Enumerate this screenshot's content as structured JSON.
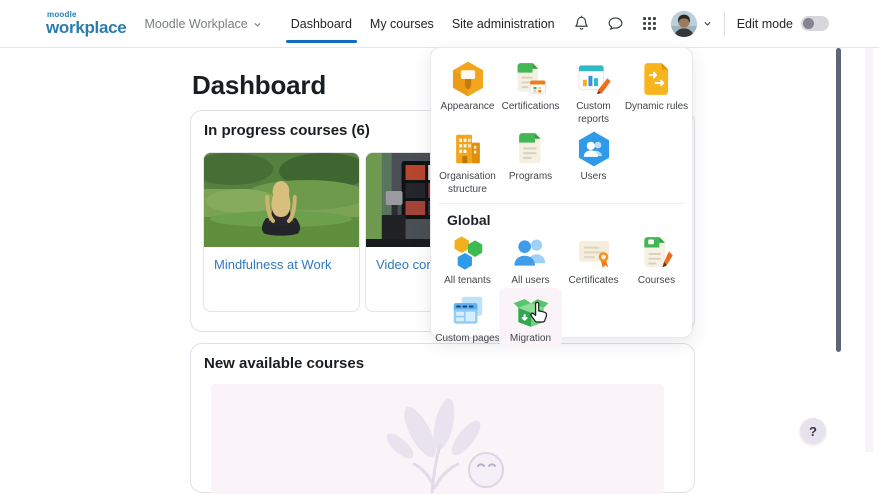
{
  "colors": {
    "brand_blue": "#2a7cb0",
    "accent_blue": "#0f6cbf",
    "link_blue": "#3178be",
    "scrollbar_thumb": "#5f6673",
    "hover_pink": "#faf4f8"
  },
  "navbar": {
    "logo_top": "moodle",
    "logo_bottom": "workplace",
    "tenant_menu": "Moodle Workplace",
    "links": [
      {
        "label": "Dashboard",
        "active": true
      },
      {
        "label": "My courses",
        "active": false
      },
      {
        "label": "Site administration",
        "active": false
      }
    ],
    "icons": [
      "notifications-bell",
      "messages",
      "app-launcher-grid",
      "user-avatar",
      "chevron-down"
    ],
    "edit_mode_label": "Edit mode",
    "edit_mode_on": false
  },
  "launcher_menu": {
    "tenant_items": [
      {
        "label": "Appearance",
        "icon": "appearance-icon"
      },
      {
        "label": "Certifications",
        "icon": "certifications-icon"
      },
      {
        "label": "Custom reports",
        "icon": "custom-reports-icon"
      },
      {
        "label": "Dynamic rules",
        "icon": "dynamic-rules-icon"
      },
      {
        "label": "Organisation structure",
        "icon": "organisation-structure-icon"
      },
      {
        "label": "Programs",
        "icon": "programs-icon"
      },
      {
        "label": "Users",
        "icon": "users-icon"
      }
    ],
    "global_heading": "Global",
    "global_items": [
      {
        "label": "All tenants",
        "icon": "all-tenants-icon"
      },
      {
        "label": "All users",
        "icon": "all-users-icon"
      },
      {
        "label": "Certificates",
        "icon": "certificates-icon"
      },
      {
        "label": "Courses",
        "icon": "courses-icon"
      },
      {
        "label": "Custom pages",
        "icon": "custom-pages-icon"
      },
      {
        "label": "Migration",
        "icon": "migration-icon",
        "hovered": true
      }
    ]
  },
  "main": {
    "page_title": "Dashboard",
    "in_progress_section": {
      "title": "In progress courses (6)",
      "courses": [
        {
          "title": "Mindfulness at Work"
        },
        {
          "title": "Video conferencing"
        }
      ]
    },
    "new_courses_section": {
      "title": "New available courses"
    }
  },
  "help_button_label": "?"
}
